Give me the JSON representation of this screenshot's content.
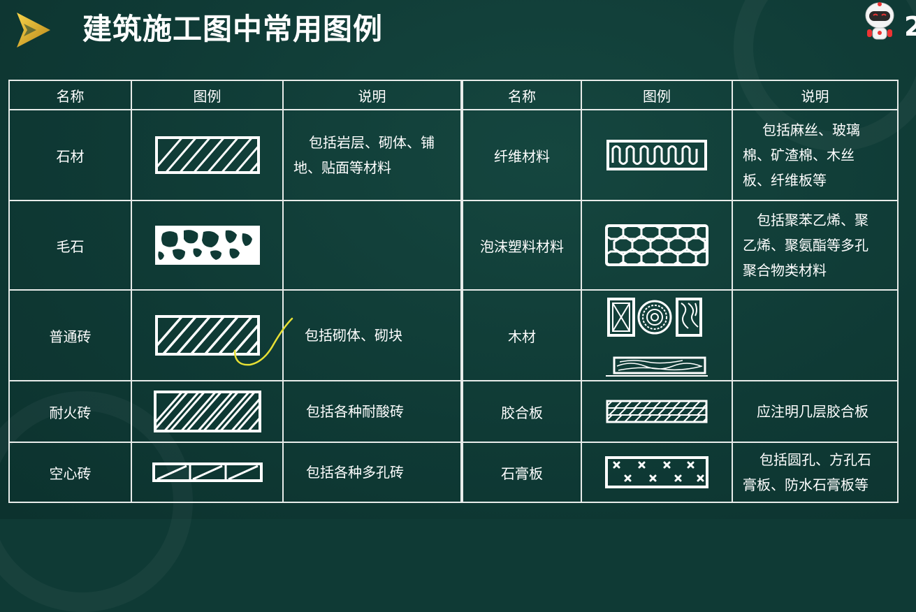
{
  "title": "建筑施工图中常用图例",
  "page_number": "2",
  "colors": {
    "background": "#0f3a35",
    "line": "#e8ecea",
    "accent": "#f2c230",
    "annotation": "#e8e035"
  },
  "table": {
    "headers": [
      "名称",
      "图例",
      "说明",
      "名称",
      "图例",
      "说明"
    ],
    "rows": [
      {
        "left": {
          "name": "石材",
          "legend_icon": "diagonal-hatch-icon",
          "desc_lines": [
            "包括岩层、砌体、铺",
            "地、贴面等材料"
          ]
        },
        "right": {
          "name": "纤维材料",
          "legend_icon": "wave-fiber-icon",
          "desc_lines": [
            "包括麻丝、玻璃",
            "棉、矿渣棉、木丝",
            "板、纤维板等"
          ]
        }
      },
      {
        "left": {
          "name": "毛石",
          "legend_icon": "rubble-stone-icon",
          "desc_lines": []
        },
        "right": {
          "name": "泡沫塑料材料",
          "legend_icon": "hexagon-foam-icon",
          "desc_lines": [
            "包括聚苯乙烯、聚",
            "乙烯、聚氨酯等多孔",
            "聚合物类材料"
          ]
        }
      },
      {
        "left": {
          "name": "普通砖",
          "legend_icon": "brick-hatch-icon",
          "desc_lines": [
            "包括砌体、砌块"
          ]
        },
        "right": {
          "name": "木材",
          "legend_icon": "wood-grain-icon",
          "desc_lines": []
        }
      },
      {
        "left": {
          "name": "耐火砖",
          "legend_icon": "firebrick-crosshatch-icon",
          "desc_lines": [
            "包括各种耐酸砖"
          ]
        },
        "right": {
          "name": "胶合板",
          "legend_icon": "plywood-layers-icon",
          "desc_lines": [
            "应注明几层胶合板"
          ]
        }
      },
      {
        "left": {
          "name": "空心砖",
          "legend_icon": "hollow-brick-icon",
          "desc_lines": [
            "包括各种多孔砖"
          ]
        },
        "right": {
          "name": "石膏板",
          "legend_icon": "gypsum-x-icon",
          "desc_lines": [
            "包括圆孔、方孔石",
            "膏板、防水石膏板等"
          ]
        }
      }
    ]
  }
}
